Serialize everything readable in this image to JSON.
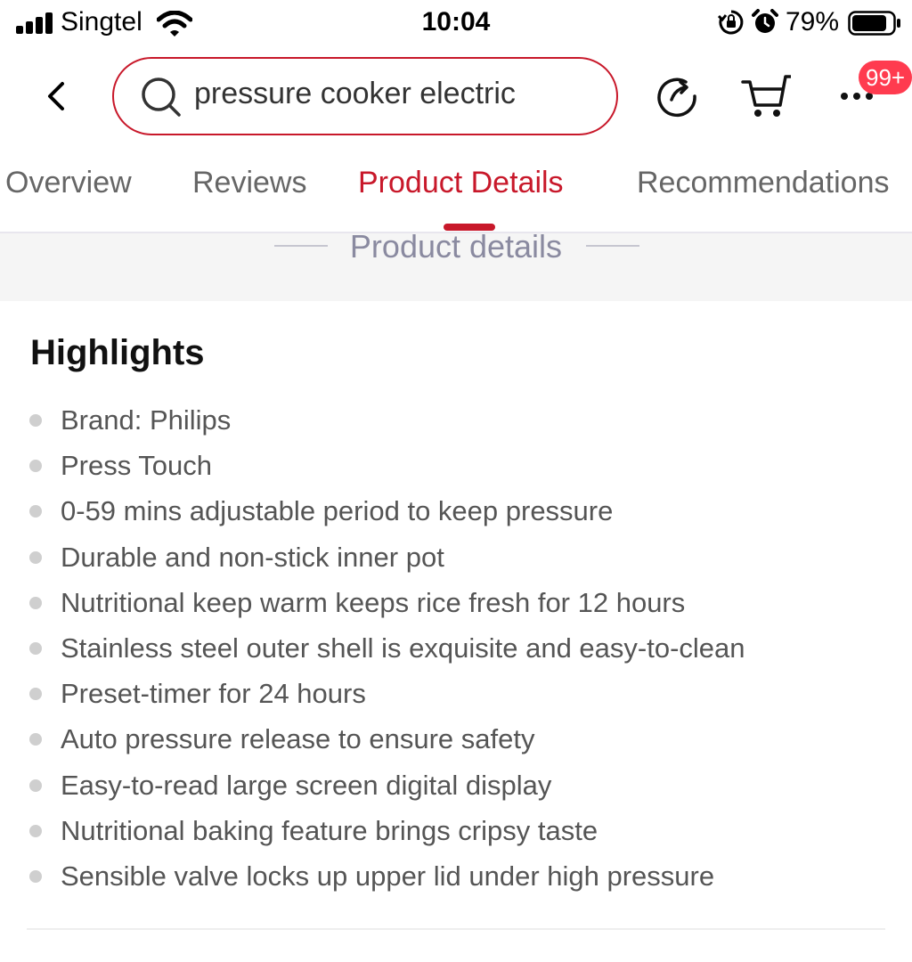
{
  "status_bar": {
    "carrier": "Singtel",
    "time": "10:04",
    "battery_percent": "79%"
  },
  "header": {
    "search_query": "pressure cooker electric",
    "cart_badge": "99+"
  },
  "tabs": [
    {
      "label": "Overview"
    },
    {
      "label": "Reviews"
    },
    {
      "label": "Product Details",
      "active": true
    },
    {
      "label": "Recommendations"
    }
  ],
  "section": {
    "title": "Product details"
  },
  "highlights": {
    "heading": "Highlights",
    "items": [
      "Brand: Philips",
      "Press Touch",
      "0-59 mins adjustable period to keep pressure",
      "Durable and non-stick inner pot",
      "Nutritional keep warm keeps rice fresh for 12 hours",
      "Stainless steel outer shell is exquisite and easy-to-clean",
      "Preset-timer for 24 hours",
      "Auto pressure release to ensure safety",
      "Easy-to-read large screen digital display",
      "Nutritional baking feature brings cripsy taste",
      "Sensible valve locks up upper lid under high pressure"
    ]
  },
  "colors": {
    "accent": "#c8182a",
    "badge": "#ff3b4f",
    "text_secondary": "#555555",
    "section_band": "#f5f5f5"
  },
  "icons": [
    "signal-icon",
    "wifi-icon",
    "rotation-lock-icon",
    "alarm-icon",
    "battery-icon",
    "back-icon",
    "search-icon",
    "share-icon",
    "cart-icon",
    "more-icon"
  ]
}
